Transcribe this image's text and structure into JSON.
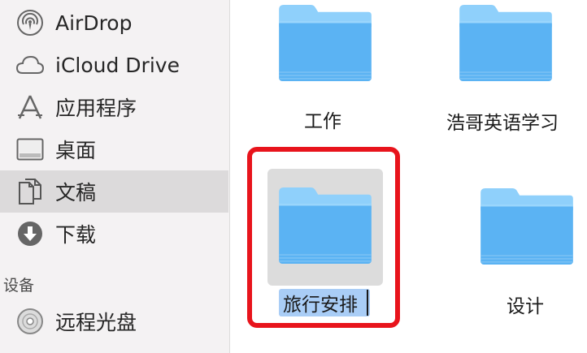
{
  "sidebar": {
    "items": [
      {
        "label": "AirDrop",
        "icon": "airdrop-icon"
      },
      {
        "label": "iCloud Drive",
        "icon": "cloud-icon"
      },
      {
        "label": "应用程序",
        "icon": "applications-icon"
      },
      {
        "label": "桌面",
        "icon": "desktop-icon"
      },
      {
        "label": "文稿",
        "icon": "documents-icon",
        "selected": true
      },
      {
        "label": "下载",
        "icon": "downloads-icon"
      }
    ],
    "section_devices": "设备",
    "devices": [
      {
        "label": "远程光盘",
        "icon": "disc-icon"
      }
    ]
  },
  "folders": [
    {
      "name": "工作"
    },
    {
      "name": "浩哥英语学习"
    },
    {
      "name": "旅行安排",
      "selected": true,
      "renaming": true
    },
    {
      "name": "设计"
    }
  ],
  "colors": {
    "folder_light": "#8fd0fb",
    "folder_main": "#5bb3f3",
    "selection_text": "#a9cdf6",
    "highlight": "#e8141c"
  }
}
